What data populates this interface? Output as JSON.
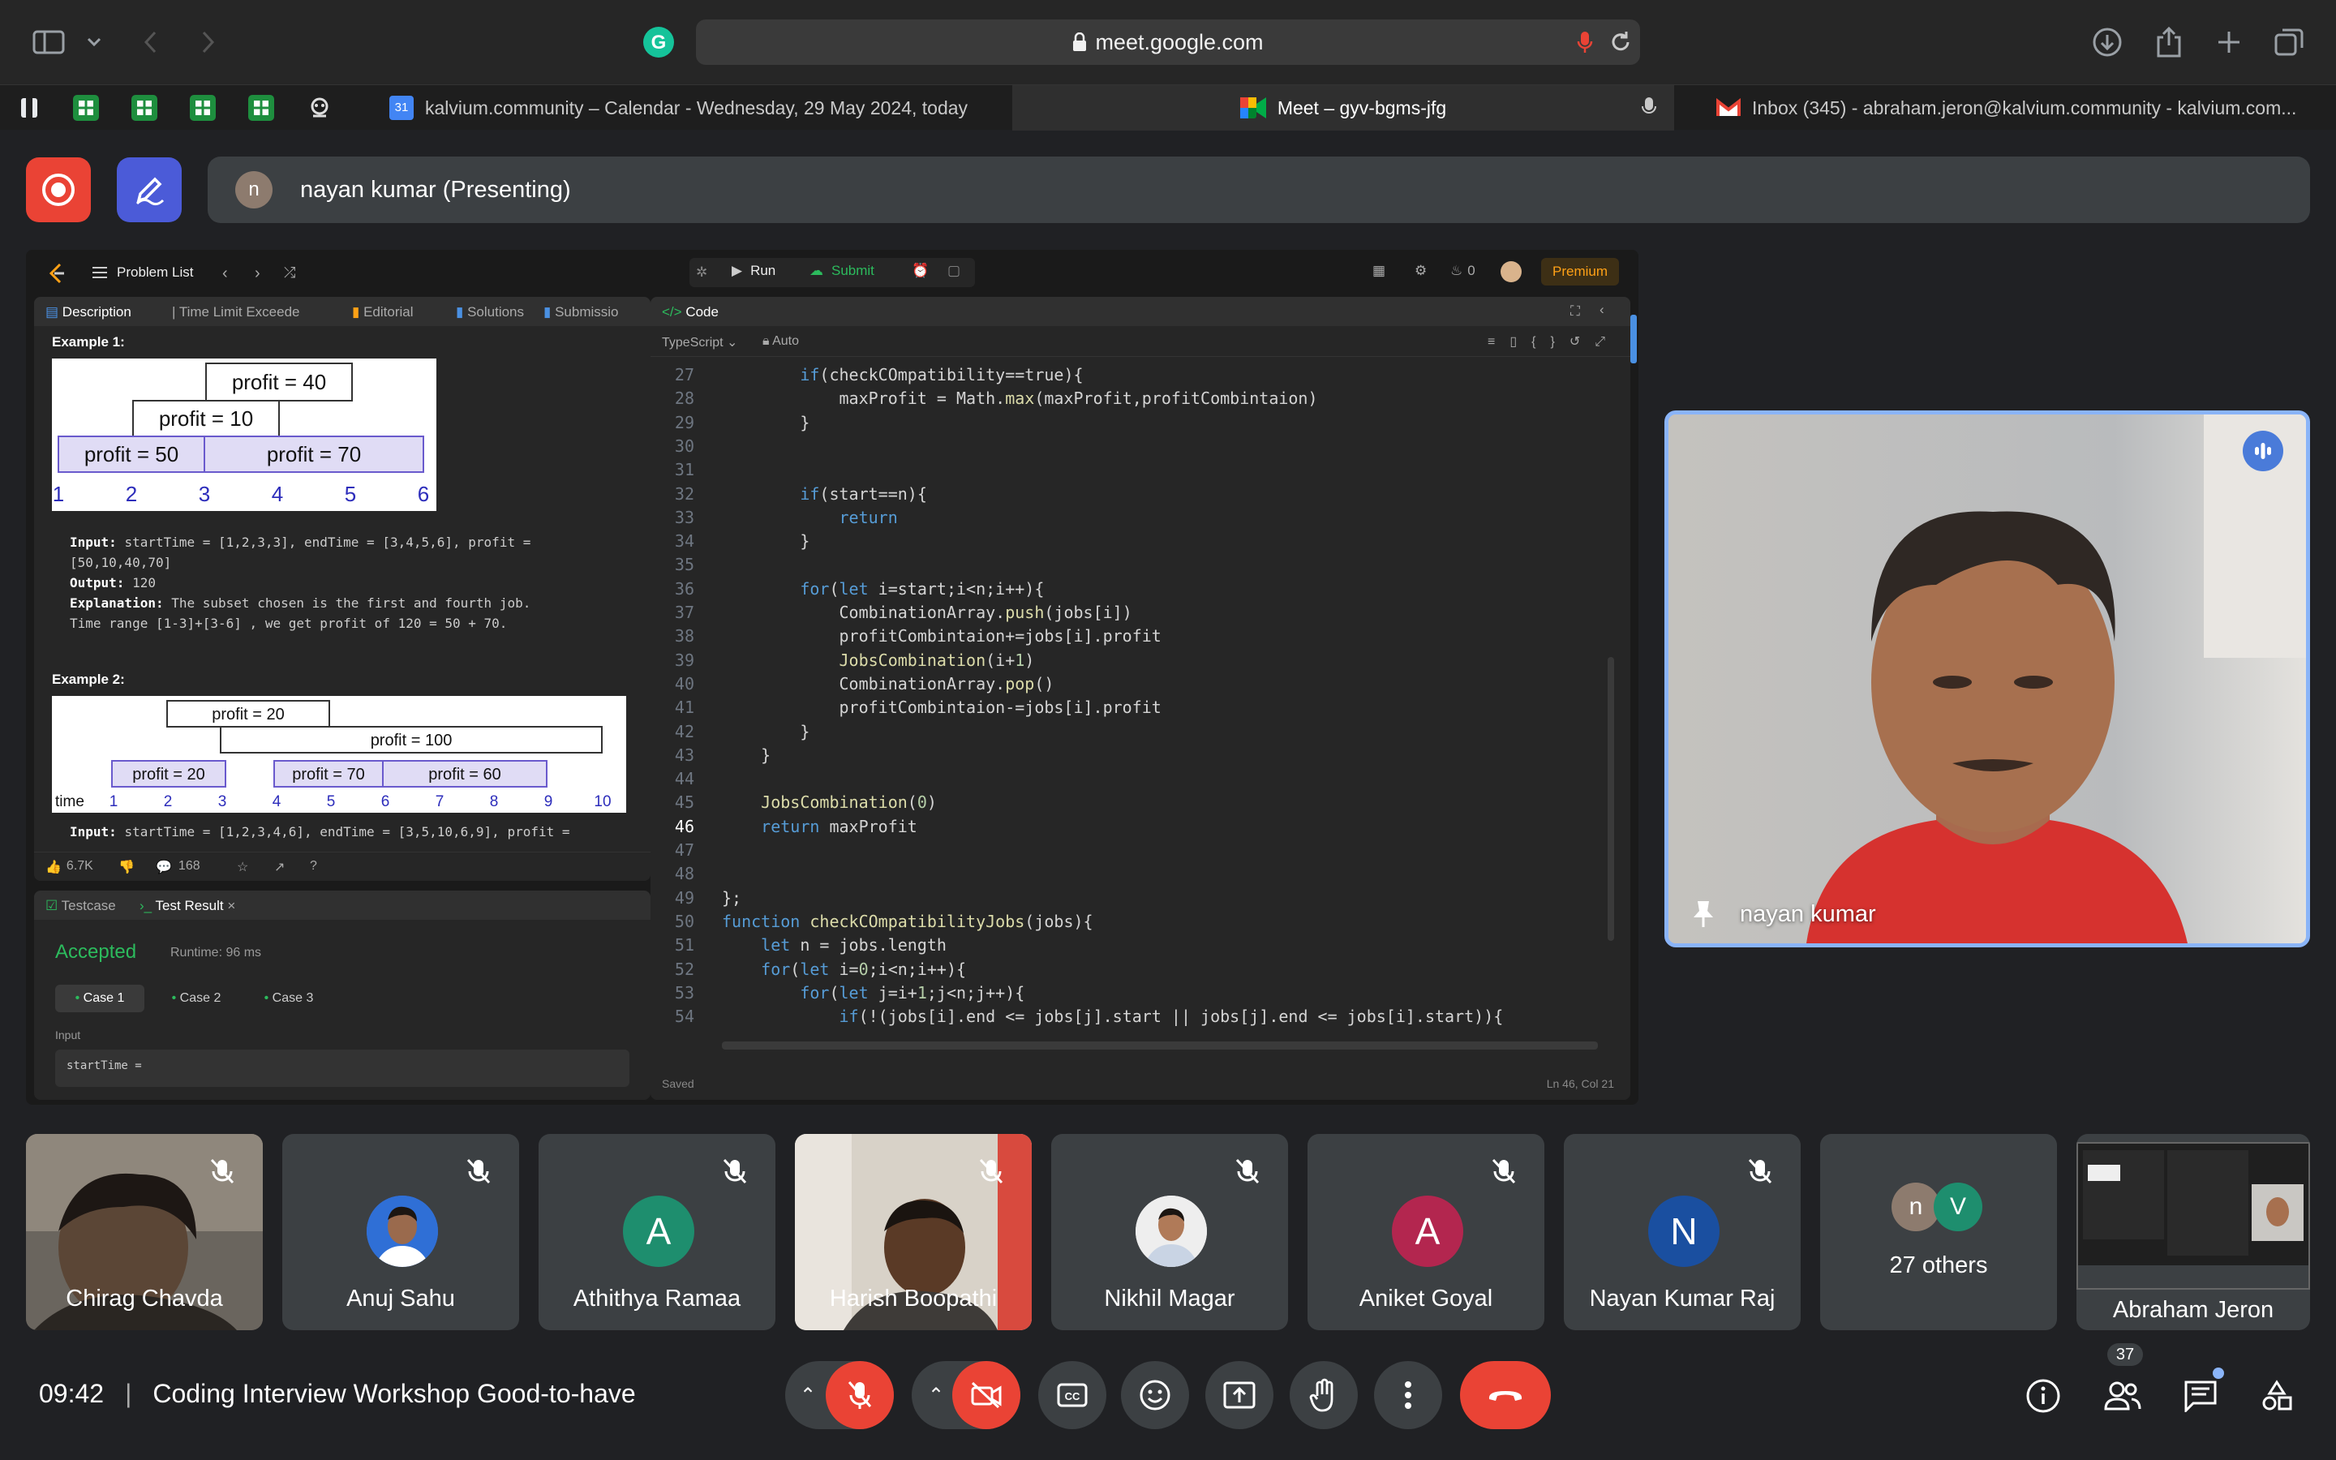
{
  "browser": {
    "url": "meet.google.com",
    "tabs": [
      {
        "title": "kalvium.community – Calendar - Wednesday, 29 May 2024, today"
      },
      {
        "title": "Meet – gyv-bgms-jfg"
      },
      {
        "title": "Inbox (345) - abraham.jeron@kalvium.community - kalvium.com..."
      }
    ]
  },
  "meet": {
    "presenter_initial": "n",
    "presenter_label": "nayan kumar (Presenting)",
    "main_speaker_name": "nayan kumar",
    "time": "09:42",
    "separator": "|",
    "meeting_title": "Coding Interview Workshop Good-to-have",
    "participant_count": "37",
    "participants": [
      {
        "name": "Chirag Chavda",
        "type": "video"
      },
      {
        "name": "Anuj Sahu",
        "type": "photo"
      },
      {
        "name": "Athithya Ramaa",
        "type": "initial",
        "initial": "A",
        "color": "#1e8e6e"
      },
      {
        "name": "Harish Boopathi",
        "type": "video"
      },
      {
        "name": "Nikhil Magar",
        "type": "photo"
      },
      {
        "name": "Aniket Goyal",
        "type": "initial",
        "initial": "A",
        "color": "#b3264f"
      },
      {
        "name": "Nayan Kumar Raj",
        "type": "initial",
        "initial": "N",
        "color": "#1a4fa0"
      },
      {
        "name": "27 others",
        "type": "others",
        "initials": [
          "n",
          "V"
        ]
      },
      {
        "name": "Abraham Jeron",
        "type": "self"
      }
    ]
  },
  "leetcode": {
    "problem_list": "Problem List",
    "run": "Run",
    "submit": "Submit",
    "streak": "0",
    "premium": "Premium",
    "tabs": [
      "Description",
      "Time Limit Exceede",
      "Editorial",
      "Solutions",
      "Submissio"
    ],
    "example1_title": "Example 1:",
    "ex1_chart": {
      "labels": [
        "profit = 40",
        "profit = 10",
        "profit = 50",
        "profit = 70"
      ],
      "ticks": [
        "1",
        "2",
        "3",
        "4",
        "5",
        "6"
      ]
    },
    "ex1_input_label": "Input:",
    "ex1_input": "startTime = [1,2,3,3], endTime = [3,4,5,6], profit =",
    "ex1_input2": "[50,10,40,70]",
    "ex1_output_label": "Output:",
    "ex1_output": "120",
    "ex1_expl_label": "Explanation:",
    "ex1_expl": "The subset chosen is the first and fourth job.",
    "ex1_expl2": "Time range [1-3]+[3-6] , we get profit of 120 = 50 + 70.",
    "example2_title": "Example 2:",
    "ex2_chart": {
      "labels": [
        "profit = 20",
        "profit = 100",
        "profit = 20",
        "profit = 70",
        "profit = 60"
      ],
      "time_label": "time",
      "ticks": [
        "1",
        "2",
        "3",
        "4",
        "5",
        "6",
        "7",
        "8",
        "9",
        "10"
      ]
    },
    "ex2_input_label": "Input:",
    "ex2_input": "startTime = [1,2,3,4,6], endTime = [3,5,10,6,9], profit =",
    "likes": "6.7K",
    "comments": "168",
    "testcase_tab": "Testcase",
    "test_result_tab": "Test Result",
    "accepted": "Accepted",
    "runtime": "Runtime: 96 ms",
    "cases": [
      "Case 1",
      "Case 2",
      "Case 3"
    ],
    "input_label": "Input",
    "input_value": "startTime =",
    "code_title": "Code",
    "language": "TypeScript",
    "auto": "Auto",
    "saved": "Saved",
    "cursor": "Ln 46, Col 21",
    "code_lines": [
      {
        "n": "27",
        "t": "        if(checkCOmpatibility==true){"
      },
      {
        "n": "28",
        "t": "            maxProfit = Math.max(maxProfit,profitCombintaion)"
      },
      {
        "n": "29",
        "t": "        }"
      },
      {
        "n": "30",
        "t": ""
      },
      {
        "n": "31",
        "t": ""
      },
      {
        "n": "32",
        "t": "        if(start==n){"
      },
      {
        "n": "33",
        "t": "            return"
      },
      {
        "n": "34",
        "t": "        }"
      },
      {
        "n": "35",
        "t": ""
      },
      {
        "n": "36",
        "t": "        for(let i=start;i<n;i++){"
      },
      {
        "n": "37",
        "t": "            CombinationArray.push(jobs[i])"
      },
      {
        "n": "38",
        "t": "            profitCombintaion+=jobs[i].profit"
      },
      {
        "n": "39",
        "t": "            JobsCombination(i+1)"
      },
      {
        "n": "40",
        "t": "            CombinationArray.pop()"
      },
      {
        "n": "41",
        "t": "            profitCombintaion-=jobs[i].profit"
      },
      {
        "n": "42",
        "t": "        }"
      },
      {
        "n": "43",
        "t": "    }"
      },
      {
        "n": "44",
        "t": ""
      },
      {
        "n": "45",
        "t": "    JobsCombination(0)"
      },
      {
        "n": "46",
        "t": "    return maxProfit"
      },
      {
        "n": "47",
        "t": ""
      },
      {
        "n": "48",
        "t": ""
      },
      {
        "n": "49",
        "t": "};"
      },
      {
        "n": "50",
        "t": "function checkCOmpatibilityJobs(jobs){"
      },
      {
        "n": "51",
        "t": "    let n = jobs.length"
      },
      {
        "n": "52",
        "t": "    for(let i=0;i<n;i++){"
      },
      {
        "n": "53",
        "t": "        for(let j=i+1;j<n;j++){"
      },
      {
        "n": "54",
        "t": "            if(!(jobs[i].end <= jobs[j].start || jobs[j].end <= jobs[i].start)){"
      }
    ]
  },
  "icons": [
    "sidebar-icon",
    "chevron-down-icon",
    "back-icon",
    "forward-icon",
    "grammarly-icon",
    "lock-icon",
    "mic-icon",
    "reload-icon",
    "download-icon",
    "share-icon",
    "plus-icon",
    "tabs-icon",
    "record-icon",
    "pen-icon",
    "pin-icon",
    "speaking-icon",
    "muted-mic-icon",
    "caption-icon",
    "emoji-icon",
    "present-icon",
    "hand-icon",
    "more-icon",
    "end-call-icon",
    "info-icon",
    "people-icon",
    "chat-icon",
    "activities-icon"
  ]
}
